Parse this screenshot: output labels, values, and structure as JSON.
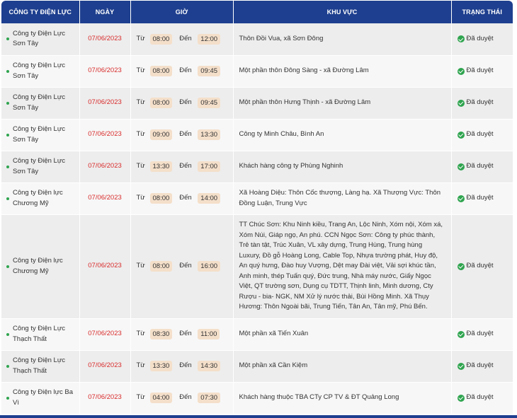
{
  "header": {
    "company": "CÔNG TY ĐIỆN LỰC",
    "date": "NGÀY",
    "time": "GIỜ",
    "area": "KHU VỰC",
    "status": "TRẠNG THÁI"
  },
  "labels": {
    "from": "Từ",
    "to": "Đến"
  },
  "colors": {
    "header_bg": "#1e3f8f",
    "date_text": "#d92b2b",
    "time_pill": "#f4dfca",
    "status_icon": "#2fa44f"
  },
  "rows": [
    {
      "company": "Công ty Điện Lực Sơn Tây",
      "date": "07/06/2023",
      "from": "08:00",
      "to": "12:00",
      "area": "Thôn Đồi Vua, xã Sơn Đông",
      "status": "Đã duyệt"
    },
    {
      "company": "Công ty Điện Lực Sơn Tây",
      "date": "07/06/2023",
      "from": "08:00",
      "to": "09:45",
      "area": "Một phần thôn Đông Sàng - xã Đường Lâm",
      "status": "Đã duyệt"
    },
    {
      "company": "Công ty Điện Lực Sơn Tây",
      "date": "07/06/2023",
      "from": "08:00",
      "to": "09:45",
      "area": "Một phần thôn Hưng Thịnh - xã Đường Lâm",
      "status": "Đã duyệt"
    },
    {
      "company": "Công ty Điện Lực Sơn Tây",
      "date": "07/06/2023",
      "from": "09:00",
      "to": "13:30",
      "area": "Công ty Minh Châu, Bình An",
      "status": "Đã duyệt"
    },
    {
      "company": "Công ty Điện Lực Sơn Tây",
      "date": "07/06/2023",
      "from": "13:30",
      "to": "17:00",
      "area": "Khách hàng công ty Phùng Nghinh",
      "status": "Đã duyệt"
    },
    {
      "company": "Công ty Điện lực Chương Mỹ",
      "date": "07/06/2023",
      "from": "08:00",
      "to": "14:00",
      "area": "Xã Hoàng Diệu: Thôn Cốc thượng, Làng hạ. Xã Thượng Vực: Thôn Đồng Luận, Trung Vực",
      "status": "Đã duyệt"
    },
    {
      "company": "Công ty Điện lực Chương Mỹ",
      "date": "07/06/2023",
      "from": "08:00",
      "to": "16:00",
      "area": "TT Chúc Sơn: Khu Ninh kiều, Trang An, Lộc Ninh, Xóm nội, Xóm xá, Xóm Núi, Giáp ngọ, An phú. CCN Ngọc Sơn: Công ty phúc thành, Trẻ tàn tật, Trúc Xuân, VL xây dựng, Trung Hùng, Trung hùng Luxury, Đồ gỗ Hoàng Long, Cable Top, Nhựa trường phát, Huy độ, An quý hưng, Đào huy Vượng, Dệt may Đài việt, Vải sợi khúc tần, Anh minh, thép Tuấn quý, Đức trung, Nhà máy nước, Giấy Ngọc Việt, QT trường sơn, Dụng cụ TDTT, Thịnh linh, Minh dương, Cty Rượu - bia- NGK, NM Xử lý nước thải, Bùi Hồng Minh. Xã Thụy Hương: Thôn Ngoài bãi, Trung Tiến, Tân An, Tân mỹ, Phú Bến.",
      "status": "Đã duyệt"
    },
    {
      "company": "Công ty Điện Lực Thạch Thất",
      "date": "07/06/2023",
      "from": "08:30",
      "to": "11:00",
      "area": "Một phần xã Tiến Xuân",
      "status": "Đã duyệt"
    },
    {
      "company": "Công ty Điện Lực Thạch Thất",
      "date": "07/06/2023",
      "from": "13:30",
      "to": "14:30",
      "area": "Một phần xã Cần Kiệm",
      "status": "Đã duyệt"
    },
    {
      "company": "Công ty Điện lực Ba Vì",
      "date": "07/06/2023",
      "from": "04:00",
      "to": "07:30",
      "area": "Khách hàng thuộc TBA CTy CP TV & ĐT Quảng Long",
      "status": "Đã duyệt"
    }
  ]
}
